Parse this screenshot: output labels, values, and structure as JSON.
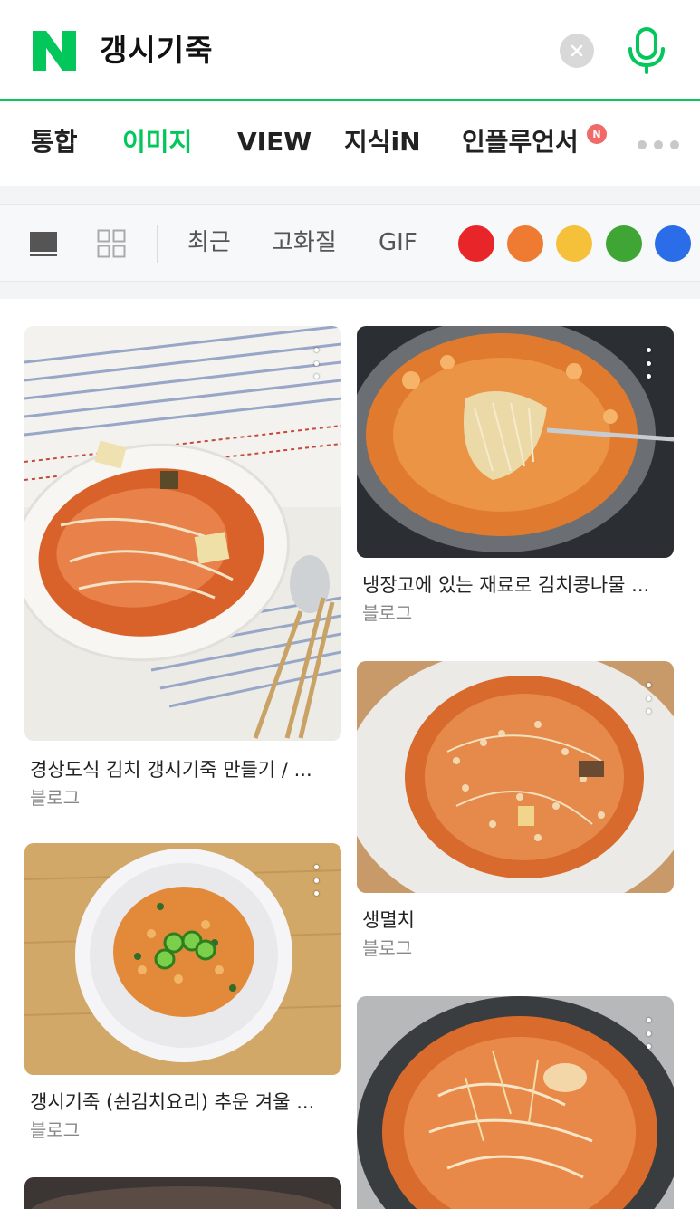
{
  "search": {
    "logo_letter": "N",
    "query": "갱시기죽"
  },
  "tabs": [
    {
      "label": "통합",
      "active": false
    },
    {
      "label": "이미지",
      "active": true
    },
    {
      "label": "VIEW",
      "active": false
    },
    {
      "label": "지식iN",
      "active": false
    },
    {
      "label": "인플루언서",
      "active": false,
      "badge": "N"
    }
  ],
  "filters": {
    "options": [
      "최근",
      "고화질",
      "GIF"
    ],
    "colors": [
      "#e8262a",
      "#ef7a31",
      "#f5c13b",
      "#3fa535",
      "#2b6de8"
    ]
  },
  "results": [
    {
      "title": "경상도식 김치 갱시기죽 만들기 / ...",
      "source": "블로그"
    },
    {
      "title": "냉장고에 있는 재료로 김치콩나물 ...",
      "source": "블로그"
    },
    {
      "title": "갱시기죽 (쉰김치요리) 추운 겨울 ...",
      "source": "블로그"
    },
    {
      "title": "생멸치",
      "source": "블로그"
    }
  ],
  "colors": {
    "brand_green": "#03c75a",
    "text_dark": "#222222",
    "text_muted": "#888888"
  }
}
